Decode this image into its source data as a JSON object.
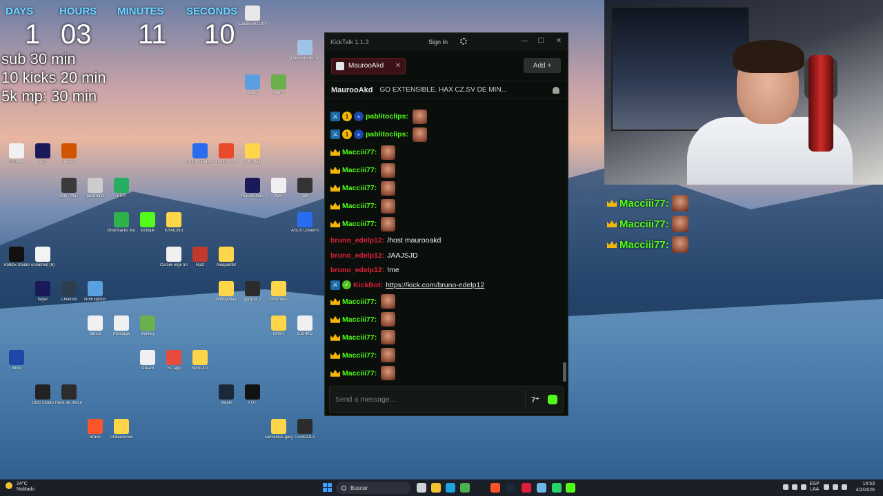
{
  "countdown": {
    "labels": [
      "DAYS",
      "HOURS",
      "MINUTES",
      "SECONDS"
    ],
    "values": [
      "1",
      "03",
      "11",
      "10"
    ]
  },
  "goals": [
    "sub 30 min",
    "10 kicks 20 min",
    "5k mp: 30 min"
  ],
  "desktop_icons": [
    {
      "label": "Guidelines Streamo",
      "color": "#e8e8e8"
    },
    {
      "label": "mario",
      "color": "#6ab04c"
    },
    {
      "label": "fuegos",
      "color": "#d35400"
    },
    {
      "label": "gargolas",
      "color": "#ffd54a"
    },
    {
      "label": "FIFA",
      "color": "#27ae60"
    },
    {
      "label": "gol!",
      "color": "#333333"
    },
    {
      "label": "KRAIONS",
      "color": "#ffd54a"
    },
    {
      "label": "unnamed (6)",
      "color": "#f3f3f3"
    },
    {
      "label": "meapanter",
      "color": "#ffd54a"
    },
    {
      "label": "NotExplorer",
      "color": "#5aa0e0"
    },
    {
      "label": "chismoso",
      "color": "#ffd54a"
    },
    {
      "label": "Monkey",
      "color": "#6ab04c"
    },
    {
      "label": "Inicio",
      "color": "#1e47a8"
    },
    {
      "label": "SMSOUL",
      "color": "#ffd54a"
    },
    {
      "label": "Pack de Recursos",
      "color": "#2c2c2c"
    },
    {
      "label": "FUT",
      "color": "#111111"
    },
    {
      "label": "Grabaciones",
      "color": "#ffd54a"
    },
    {
      "label": "GARGOLA",
      "color": "#2c2c2c"
    },
    {
      "label": "fondo",
      "color": "#5aa0e0"
    },
    {
      "label": "AE",
      "color": "#1a1a5a"
    },
    {
      "label": "mario bross",
      "color": "#e84a2a"
    },
    {
      "label": "bestfrend",
      "color": "#cccccc"
    },
    {
      "label": "flyer",
      "color": "#f0f0f0"
    },
    {
      "label": "kicktalk",
      "color": "#53fc18"
    },
    {
      "label": "Roblox Studio",
      "color": "#111111"
    },
    {
      "label": "Rust",
      "color": "#c0392b"
    },
    {
      "label": "Chilenos",
      "color": "#2c3e50"
    },
    {
      "label": "gargola 2",
      "color": "#2c2c2c"
    },
    {
      "label": "message",
      "color": "#f0f0f0"
    },
    {
      "label": "DSHMC",
      "color": "#f0f0f0"
    },
    {
      "label": "EA app",
      "color": "#e74c3c"
    },
    {
      "label": "OBS Studio",
      "color": "#222222"
    },
    {
      "label": "Steam",
      "color": "#1b2838"
    },
    {
      "label": "Brave",
      "color": "#fb542b"
    },
    {
      "label": "camisetas gargolas",
      "color": "#ffd54a"
    },
    {
      "label": "Papelera de reciclaje",
      "color": "#a0c4e8"
    },
    {
      "label": "Fortnite",
      "color": "#f0f0f0"
    },
    {
      "label": "Roblox Player",
      "color": "#2a6cf0"
    },
    {
      "label": "IMG_2417",
      "color": "#3a3a3a"
    },
    {
      "label": "Pro Evolution Soccer 6",
      "color": "#1a1a5a"
    },
    {
      "label": "BlueStacks Multi-Insta",
      "color": "#2fb14c"
    },
    {
      "label": "ASUS DriverHub",
      "color": "#2a6cf0"
    },
    {
      "label": "CurseForge Installer",
      "color": "#f0f0f0"
    },
    {
      "label": "flayer",
      "color": "#1a1a5a"
    },
    {
      "label": "entrevistas",
      "color": "#ffd54a"
    },
    {
      "label": "banco",
      "color": "#f0f0f0"
    },
    {
      "label": "remini",
      "color": "#ffd54a"
    },
    {
      "label": "stream",
      "color": "#f0f0f0"
    }
  ],
  "webcam": {
    "label": "webcam-feed"
  },
  "chat_overlay": [
    {
      "name": "Macciii77:"
    },
    {
      "name": "Macciii77:"
    },
    {
      "name": "Macciii77:"
    }
  ],
  "kicktalk": {
    "title": "KickTalk 1.1.3",
    "sign_in": "Sign In",
    "min": "—",
    "max": "☐",
    "close": "✕",
    "tab_label": "MaurooAkd",
    "tab_close": "✕",
    "add_label": "Add +",
    "channel_name": "MaurooAkd",
    "stream_title": "GO EXTENSIBLE. HAX CZ.SV DE MIN...",
    "messages": [
      {
        "user": "pablitoclips:",
        "color": "green",
        "badges": [
          "sword",
          "one",
          "star"
        ],
        "text": "",
        "emote": true
      },
      {
        "user": "pablitoclips:",
        "color": "green",
        "badges": [
          "sword",
          "one",
          "star"
        ],
        "text": "",
        "emote": true
      },
      {
        "user": "Macciii77:",
        "color": "green",
        "badges": [
          "crown"
        ],
        "text": "",
        "emote": true
      },
      {
        "user": "Macciii77:",
        "color": "green",
        "badges": [
          "crown"
        ],
        "text": "",
        "emote": true
      },
      {
        "user": "Macciii77:",
        "color": "green",
        "badges": [
          "crown"
        ],
        "text": "",
        "emote": true
      },
      {
        "user": "Macciii77:",
        "color": "green",
        "badges": [
          "crown"
        ],
        "text": "",
        "emote": true
      },
      {
        "user": "Macciii77:",
        "color": "green",
        "badges": [
          "crown"
        ],
        "text": "",
        "emote": true
      },
      {
        "user": "bruno_edelp12:",
        "color": "red",
        "badges": [],
        "text": "/host maurooakd",
        "emote": false
      },
      {
        "user": "bruno_edelp12:",
        "color": "red",
        "badges": [],
        "text": "JAAJSJD",
        "emote": false
      },
      {
        "user": "bruno_edelp12:",
        "color": "red",
        "badges": [],
        "text": "!me",
        "emote": false
      },
      {
        "user": "KickBot:",
        "color": "red",
        "badges": [
          "sword",
          "verified"
        ],
        "link": "https://kick.com/bruno-edelp12",
        "emote": false
      },
      {
        "user": "Macciii77:",
        "color": "green",
        "badges": [
          "crown"
        ],
        "text": "",
        "emote": true
      },
      {
        "user": "Macciii77:",
        "color": "green",
        "badges": [
          "crown"
        ],
        "text": "",
        "emote": true
      },
      {
        "user": "Macciii77:",
        "color": "green",
        "badges": [
          "crown"
        ],
        "text": "",
        "emote": true
      },
      {
        "user": "Macciii77:",
        "color": "green",
        "badges": [
          "crown"
        ],
        "text": "",
        "emote": true
      },
      {
        "user": "Macciii77:",
        "color": "green",
        "badges": [
          "crown"
        ],
        "text": "",
        "emote": true
      }
    ],
    "input_placeholder": "Send a message...",
    "translate_icon": "7⁺"
  },
  "taskbar": {
    "weather_temp": "24°C",
    "weather_desc": "Nublado",
    "search_label": "Buscar",
    "lang_top": "ESP",
    "lang_bottom": "LAA",
    "time": "14:53",
    "date": "4/2/2026",
    "apps": [
      {
        "name": "task-view",
        "color": "#cfd3d8"
      },
      {
        "name": "file-explorer",
        "color": "#f2c230"
      },
      {
        "name": "edge",
        "color": "#1fa3e0"
      },
      {
        "name": "chrome",
        "color": "#4caf50"
      },
      {
        "name": "brave",
        "color": "#fb542b"
      },
      {
        "name": "steam",
        "color": "#1b2838"
      },
      {
        "name": "app-red",
        "color": "#e0203a"
      },
      {
        "name": "notepad",
        "color": "#6fb7e8"
      },
      {
        "name": "whatsapp",
        "color": "#25d366"
      },
      {
        "name": "kick",
        "color": "#53fc18"
      }
    ]
  }
}
